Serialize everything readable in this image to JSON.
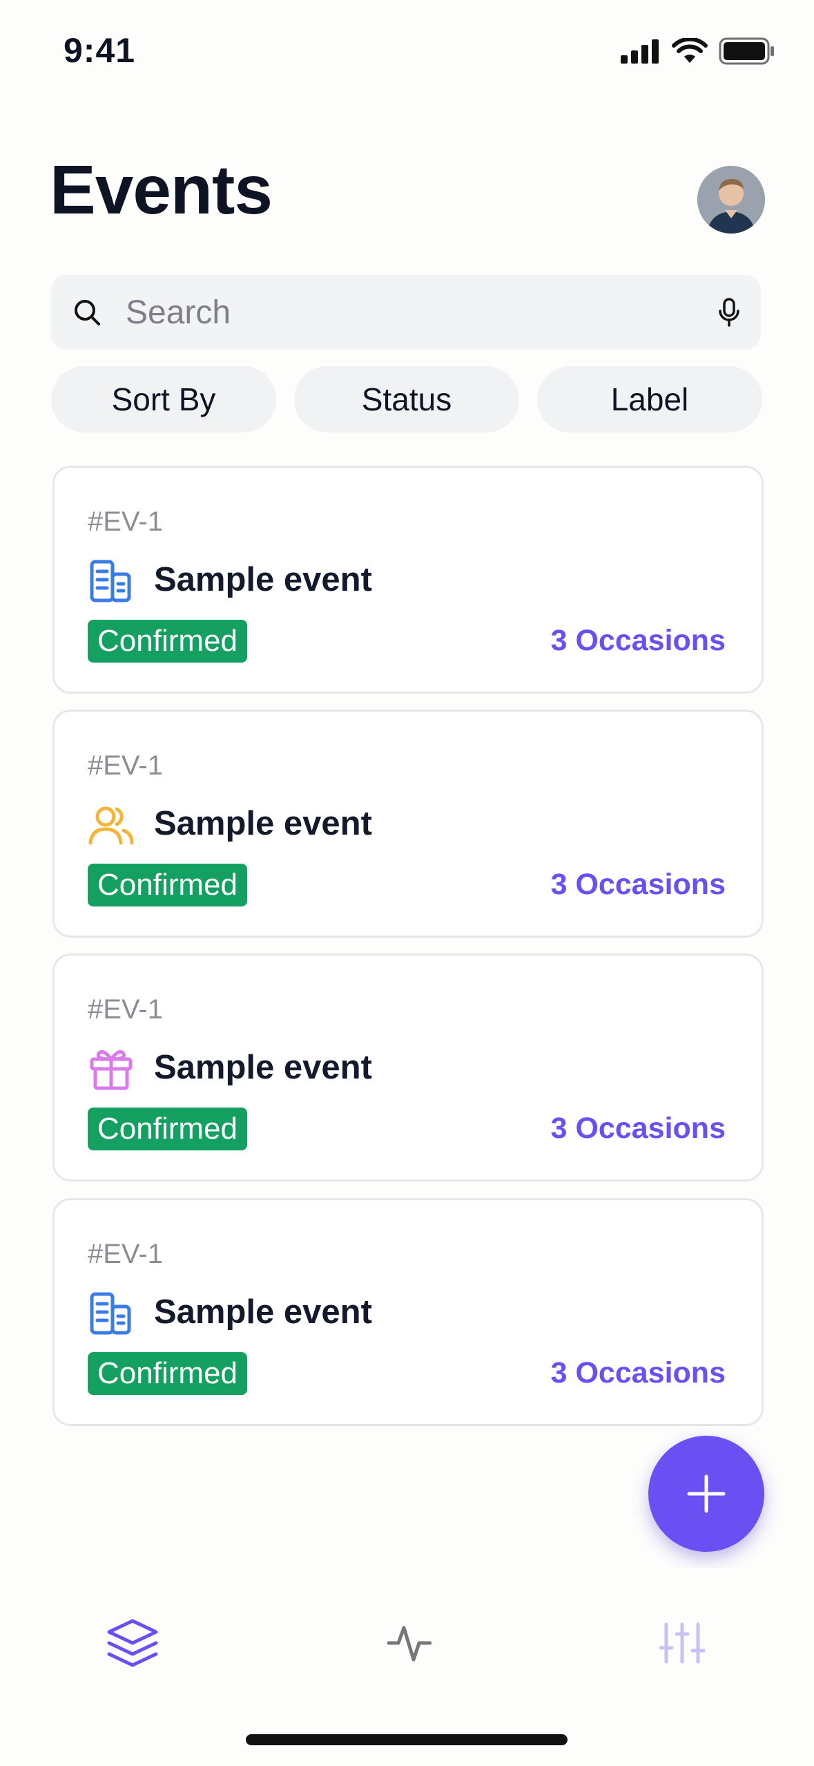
{
  "status_bar": {
    "time": "9:41"
  },
  "header": {
    "title": "Events"
  },
  "search": {
    "placeholder": "Search"
  },
  "filters": {
    "sort_by": "Sort By",
    "status": "Status",
    "label": "Label"
  },
  "events": [
    {
      "id": "#EV-1",
      "name": "Sample event",
      "status": "Confirmed",
      "occasions": "3 Occasions",
      "icon": "building-icon",
      "icon_color": "#3b7be8"
    },
    {
      "id": "#EV-1",
      "name": "Sample event",
      "status": "Confirmed",
      "occasions": "3 Occasions",
      "icon": "users-icon",
      "icon_color": "#f4b43a"
    },
    {
      "id": "#EV-1",
      "name": "Sample event",
      "status": "Confirmed",
      "occasions": "3 Occasions",
      "icon": "gift-icon",
      "icon_color": "#d97be8"
    },
    {
      "id": "#EV-1",
      "name": "Sample event",
      "status": "Confirmed",
      "occasions": "3 Occasions",
      "icon": "building-icon",
      "icon_color": "#3b7be8"
    }
  ],
  "colors": {
    "accent": "#6a4ff2",
    "confirmed": "#14a060"
  },
  "tabbar": {
    "items": [
      "layers-icon",
      "activity-icon",
      "sliders-icon"
    ],
    "active": "layers-icon"
  }
}
